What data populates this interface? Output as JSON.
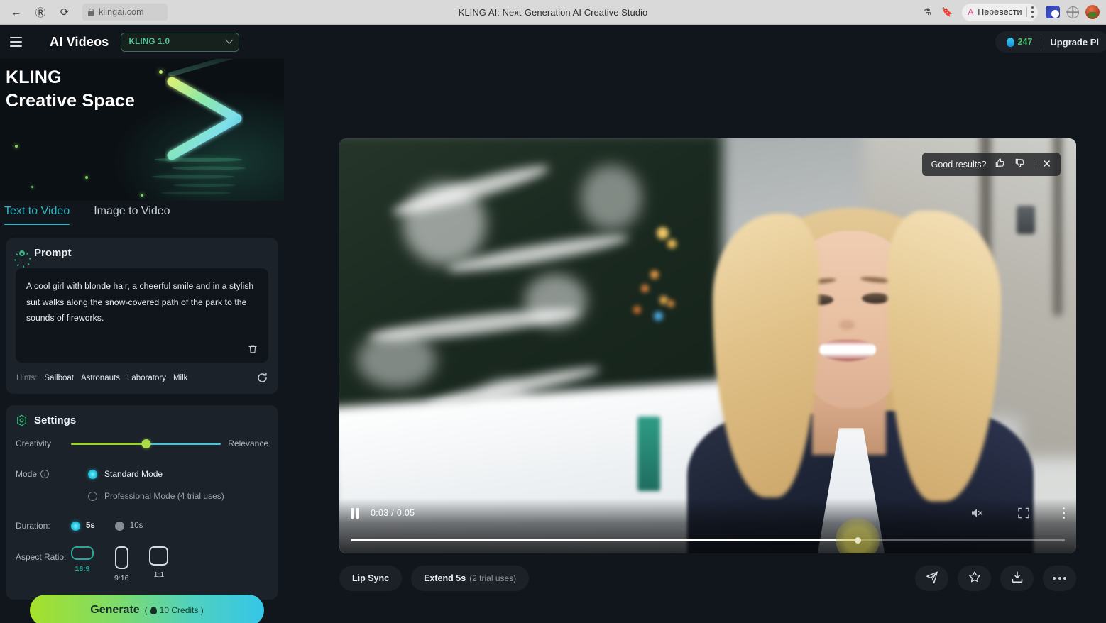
{
  "browser": {
    "back_icon": "back-arrow-icon",
    "yandex_icon": "yandex-icon",
    "reload_icon": "reload-icon",
    "lock_icon": "lock-icon",
    "url": "klingai.com",
    "tab_title": "KLING AI: Next-Generation AI Creative Studio",
    "translate_label": "Перевести",
    "right_icons": [
      "reader-icon",
      "bookmark-icon",
      "translate-icon",
      "kebab-menu-icon",
      "extension-blue-icon",
      "extension-globe-icon",
      "profile-avatar-icon"
    ]
  },
  "app_header": {
    "menu_icon": "hamburger-menu-icon",
    "title": "AI Videos",
    "model": "KLING 1.0",
    "model_chevron": "chevron-down-icon",
    "credits_icon": "flame-icon",
    "credits": "247",
    "upgrade_label": "Upgrade Pl"
  },
  "hero": {
    "line1": "KLING",
    "line2": "Creative Space",
    "logo_icon": "kling-play-logo-icon"
  },
  "tabs": [
    {
      "label": "Text to Video",
      "active": true
    },
    {
      "label": "Image to Video",
      "active": false
    }
  ],
  "prompt": {
    "icon": "sun-icon",
    "title": "Prompt",
    "text": "A cool girl with blonde hair, a cheerful smile and in a stylish suit walks along the snow-covered path of the park to the sounds of fireworks.",
    "delete_icon": "trash-icon",
    "hints_label": "Hints:",
    "hints": [
      "Sailboat",
      "Astronauts",
      "Laboratory",
      "Milk"
    ],
    "refresh_icon": "refresh-icon"
  },
  "settings": {
    "icon": "hexagon-target-icon",
    "title": "Settings",
    "creativity_label": "Creativity",
    "relevance_label": "Relevance",
    "slider_value_percent": 50,
    "mode_label": "Mode",
    "mode_info_icon": "info-icon",
    "modes": [
      {
        "label": "Standard Mode",
        "selected": true
      },
      {
        "label": "Professional Mode (4 trial uses)",
        "selected": false
      }
    ],
    "duration_label": "Duration:",
    "durations": [
      {
        "label": "5s",
        "selected": true
      },
      {
        "label": "10s",
        "selected": false
      }
    ],
    "aspect_label": "Aspect Ratio:",
    "aspect_ratios": [
      {
        "label": "16:9",
        "selected": true
      },
      {
        "label": "9:16",
        "selected": false
      },
      {
        "label": "1:1",
        "selected": false
      }
    ]
  },
  "generate": {
    "label": "Generate",
    "credits_text": "( 10 Credits )",
    "credits_icon": "flame-icon"
  },
  "player": {
    "feedback_text": "Good results?",
    "thumbs_up_icon": "thumbs-up-icon",
    "thumbs_down_icon": "thumbs-down-icon",
    "close_icon": "close-icon",
    "pause_icon": "pause-icon",
    "time": "0:03 / 0.05",
    "mute_icon": "volume-muted-icon",
    "fullscreen_icon": "fullscreen-icon",
    "more_icon": "kebab-menu-icon",
    "progress_percent": 71,
    "cursor_icon": "hand-cursor-icon"
  },
  "actions": {
    "lip_sync": "Lip Sync",
    "extend_label": "Extend 5s",
    "extend_sub": "(2 trial uses)",
    "share_icon": "share-plane-icon",
    "favorite_icon": "star-icon",
    "download_icon": "download-icon",
    "more_icon": "ellipsis-icon"
  },
  "colors": {
    "accent_teal": "#2fb6c4",
    "accent_green": "#57c79a",
    "gradient_start": "#a6e02a",
    "gradient_end": "#35c6e8",
    "panel_bg": "#1b2229",
    "app_bg": "#11161c"
  }
}
